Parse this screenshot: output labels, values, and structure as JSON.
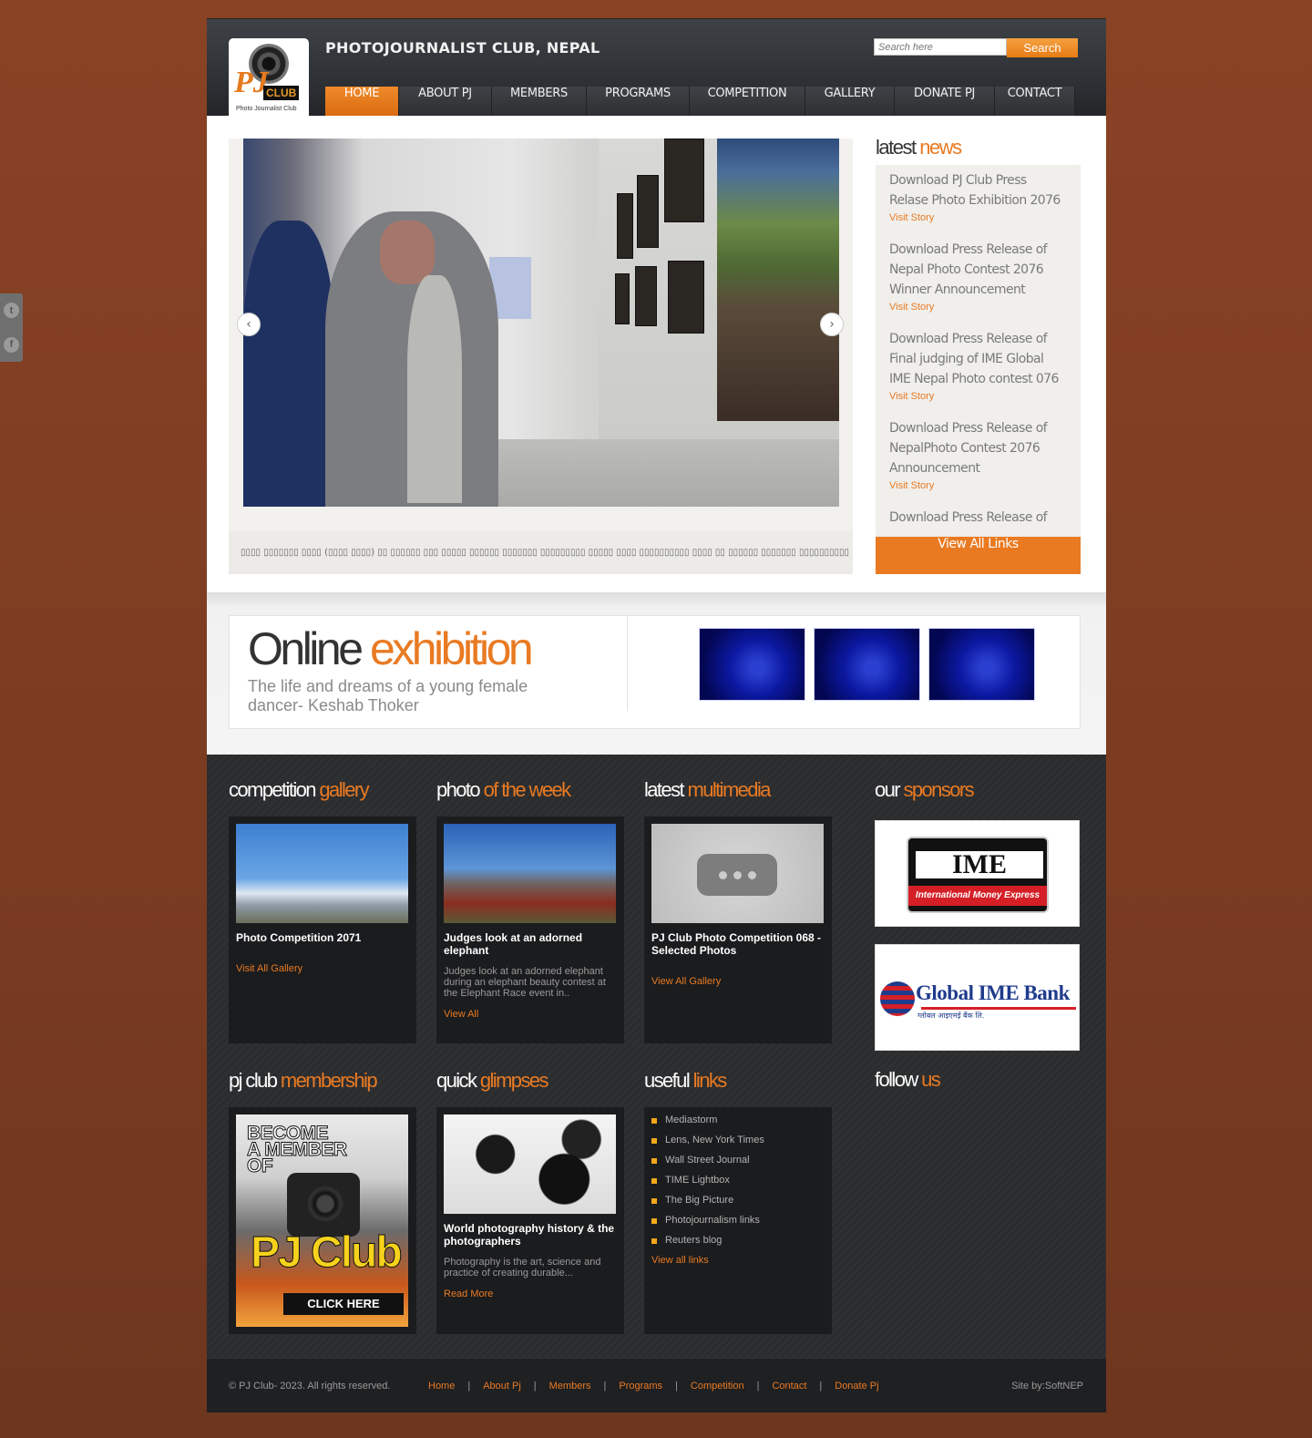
{
  "social": {
    "twitter": "t",
    "facebook": "f"
  },
  "header": {
    "site_title": "PHOTOJOURNALIST CLUB, NEPAL",
    "logo_text": "PJ",
    "logo_club": "CLUB",
    "logo_tagline": "Photo Journalist Club",
    "search_placeholder": "Search here",
    "search_label": "Search"
  },
  "nav": [
    {
      "label": "HOME",
      "active": true
    },
    {
      "label": "ABOUT PJ"
    },
    {
      "label": "MEMBERS"
    },
    {
      "label": "PROGRAMS"
    },
    {
      "label": "COMPETITION"
    },
    {
      "label": "GALLERY"
    },
    {
      "label": "DONATE PJ"
    },
    {
      "label": "CONTACT"
    }
  ],
  "slider": {
    "prev": "‹",
    "next": "›",
    "caption": "▯▯▯▯ ▯▯▯▯▯▯▯ ▯▯▯▯ (▯▯▯▯ ▯▯▯▯) ▯▯ ▯▯▯▯▯▯ ▯▯▯ ▯▯▯▯▯ ▯▯▯▯▯▯ ▯▯▯▯▯▯▯ ▯▯▯▯▯▯▯▯▯ ▯▯▯▯▯ ▯▯▯▯ ▯▯▯▯▯▯▯▯▯▯ ▯▯▯▯ ▯▯ ▯▯▯▯▯▯ ▯▯▯▯▯▯▯ ▯▯▯▯▯▯▯▯▯▯ ▯▯▯▯▯▯▯▯ ▯▯▯▯"
  },
  "latest_news": {
    "title_a": "latest",
    "title_b": "news",
    "items": [
      {
        "title": "Download PJ Club Press Relase Photo Exhibition 2076",
        "link": "Visit Story"
      },
      {
        "title": "Download Press Release of Nepal Photo Contest 2076 Winner Announcement",
        "link": "Visit Story"
      },
      {
        "title": "Download Press Release of Final judging of IME Global IME Nepal Photo contest 076",
        "link": "Visit Story"
      },
      {
        "title": "Download Press Release of NepalPhoto Contest 2076 Announcement",
        "link": "Visit Story"
      },
      {
        "title": "Download Press Release of",
        "link": ""
      }
    ],
    "view_all": "View All Links"
  },
  "exhibition": {
    "title_a": "Online",
    "title_b": "exhibition",
    "subtitle": "The life and dreams of a young female dancer- Keshab Thoker"
  },
  "competition_gallery": {
    "title_a": "competition",
    "title_b": "gallery",
    "item_title": "Photo Competition 2071",
    "link": "Visit All Gallery"
  },
  "photo_week": {
    "title_a": "photo",
    "title_b": "of the week",
    "item_title": "Judges look at an adorned elephant",
    "desc": "Judges look at an adorned elephant during an elephant beauty contest at the Elephant Race event in..",
    "link": "View All"
  },
  "multimedia": {
    "title_a": "latest",
    "title_b": "multimedia",
    "item_title": "PJ Club Photo Competition 068 - Selected Photos",
    "link": "View All Gallery"
  },
  "sponsors": {
    "title_a": "our",
    "title_b": "sponsors",
    "ime_name": "IME",
    "ime_tagline": "International Money Express",
    "gib_name": "Global IME Bank",
    "gib_sub": "ग्लोबल आइएमई बैंक लि."
  },
  "membership": {
    "title_a": "pj club",
    "title_b": "membership",
    "banner_line1": "BECOME",
    "banner_line2": "A MEMBER",
    "banner_line3": "OF",
    "banner_brand": "PJ Club",
    "banner_cta": "CLICK HERE"
  },
  "glimpses": {
    "title_a": "quick",
    "title_b": "glimpses",
    "item_title": "World photography history & the photographers",
    "desc": "Photography is the art, science and practice of creating durable...",
    "link": "Read More"
  },
  "useful_links": {
    "title_a": "useful",
    "title_b": "links",
    "items": [
      "Mediastorm",
      "Lens, New York Times",
      "Wall Street Journal",
      "TIME Lightbox",
      "The Big Picture",
      "Photojournalism links",
      "Reuters blog"
    ],
    "view_all": "View all links"
  },
  "follow": {
    "title_a": "follow",
    "title_b": "us"
  },
  "footer": {
    "copyright": "© PJ Club- 2023. All rights reserved.",
    "links": [
      "Home",
      "About Pj",
      "Members",
      "Programs",
      "Competition",
      "Contact",
      "Donate Pj"
    ],
    "separator": "|",
    "site_by": "Site by:SoftNEP"
  }
}
